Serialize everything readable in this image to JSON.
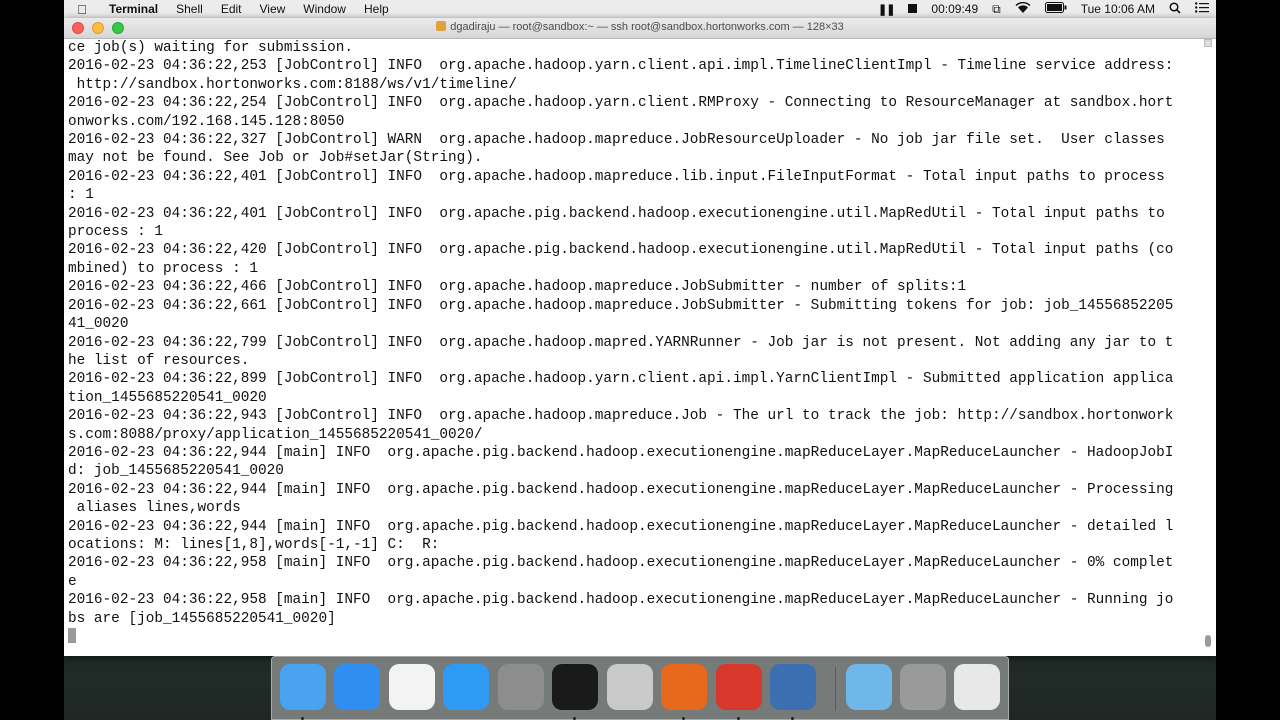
{
  "menubar": {
    "app_name": "Terminal",
    "items": [
      "Shell",
      "Edit",
      "View",
      "Window",
      "Help"
    ],
    "timer": "00:09:49",
    "clock": "Tue 10:06 AM"
  },
  "window": {
    "title": "dgadiraju — root@sandbox:~ — ssh root@sandbox.hortonworks.com — 128×33"
  },
  "terminal": {
    "lines": [
      "ce job(s) waiting for submission.",
      "2016-02-23 04:36:22,253 [JobControl] INFO  org.apache.hadoop.yarn.client.api.impl.TimelineClientImpl - Timeline service address:",
      " http://sandbox.hortonworks.com:8188/ws/v1/timeline/",
      "2016-02-23 04:36:22,254 [JobControl] INFO  org.apache.hadoop.yarn.client.RMProxy - Connecting to ResourceManager at sandbox.hort",
      "onworks.com/192.168.145.128:8050",
      "2016-02-23 04:36:22,327 [JobControl] WARN  org.apache.hadoop.mapreduce.JobResourceUploader - No job jar file set.  User classes",
      "may not be found. See Job or Job#setJar(String).",
      "2016-02-23 04:36:22,401 [JobControl] INFO  org.apache.hadoop.mapreduce.lib.input.FileInputFormat - Total input paths to process",
      ": 1",
      "2016-02-23 04:36:22,401 [JobControl] INFO  org.apache.pig.backend.hadoop.executionengine.util.MapRedUtil - Total input paths to",
      "process : 1",
      "2016-02-23 04:36:22,420 [JobControl] INFO  org.apache.pig.backend.hadoop.executionengine.util.MapRedUtil - Total input paths (co",
      "mbined) to process : 1",
      "2016-02-23 04:36:22,466 [JobControl] INFO  org.apache.hadoop.mapreduce.JobSubmitter - number of splits:1",
      "2016-02-23 04:36:22,661 [JobControl] INFO  org.apache.hadoop.mapreduce.JobSubmitter - Submitting tokens for job: job_14556852205",
      "41_0020",
      "2016-02-23 04:36:22,799 [JobControl] INFO  org.apache.hadoop.mapred.YARNRunner - Job jar is not present. Not adding any jar to t",
      "he list of resources.",
      "2016-02-23 04:36:22,899 [JobControl] INFO  org.apache.hadoop.yarn.client.api.impl.YarnClientImpl - Submitted application applica",
      "tion_1455685220541_0020",
      "2016-02-23 04:36:22,943 [JobControl] INFO  org.apache.hadoop.mapreduce.Job - The url to track the job: http://sandbox.hortonwork",
      "s.com:8088/proxy/application_1455685220541_0020/",
      "2016-02-23 04:36:22,944 [main] INFO  org.apache.pig.backend.hadoop.executionengine.mapReduceLayer.MapReduceLauncher - HadoopJobI",
      "d: job_1455685220541_0020",
      "2016-02-23 04:36:22,944 [main] INFO  org.apache.pig.backend.hadoop.executionengine.mapReduceLayer.MapReduceLauncher - Processing",
      " aliases lines,words",
      "2016-02-23 04:36:22,944 [main] INFO  org.apache.pig.backend.hadoop.executionengine.mapReduceLayer.MapReduceLauncher - detailed l",
      "ocations: M: lines[1,8],words[-1,-1] C:  R:",
      "2016-02-23 04:36:22,958 [main] INFO  org.apache.pig.backend.hadoop.executionengine.mapReduceLayer.MapReduceLauncher - 0% complet",
      "e",
      "2016-02-23 04:36:22,958 [main] INFO  org.apache.pig.backend.hadoop.executionengine.mapReduceLayer.MapReduceLauncher - Running jo",
      "bs are [job_1455685220541_0020]"
    ]
  },
  "dock": {
    "apps": [
      {
        "icon": "finder-icon",
        "color": "#4aa3ef",
        "running": true
      },
      {
        "icon": "safari-icon",
        "color": "#2f8ef0",
        "running": false
      },
      {
        "icon": "itunes-icon",
        "color": "#f3f3f3",
        "running": false
      },
      {
        "icon": "app-store-icon",
        "color": "#2d9af4",
        "running": false
      },
      {
        "icon": "system-preferences-icon",
        "color": "#8d8d8d",
        "running": false
      },
      {
        "icon": "terminal-icon",
        "color": "#1a1a1a",
        "running": true
      },
      {
        "icon": "network-utility-icon",
        "color": "#c9c9c9",
        "running": false
      },
      {
        "icon": "firefox-icon",
        "color": "#e8691c",
        "running": true
      },
      {
        "icon": "parallels-icon",
        "color": "#d8372c",
        "running": true
      },
      {
        "icon": "screen-recorder-icon",
        "color": "#3b6fb2",
        "running": true
      }
    ],
    "others": [
      {
        "icon": "applications-folder-icon",
        "color": "#6fb7e8"
      },
      {
        "icon": "downloads-stack-icon",
        "color": "#9a9a9a"
      },
      {
        "icon": "trash-icon",
        "color": "#e8e8e8"
      }
    ]
  }
}
